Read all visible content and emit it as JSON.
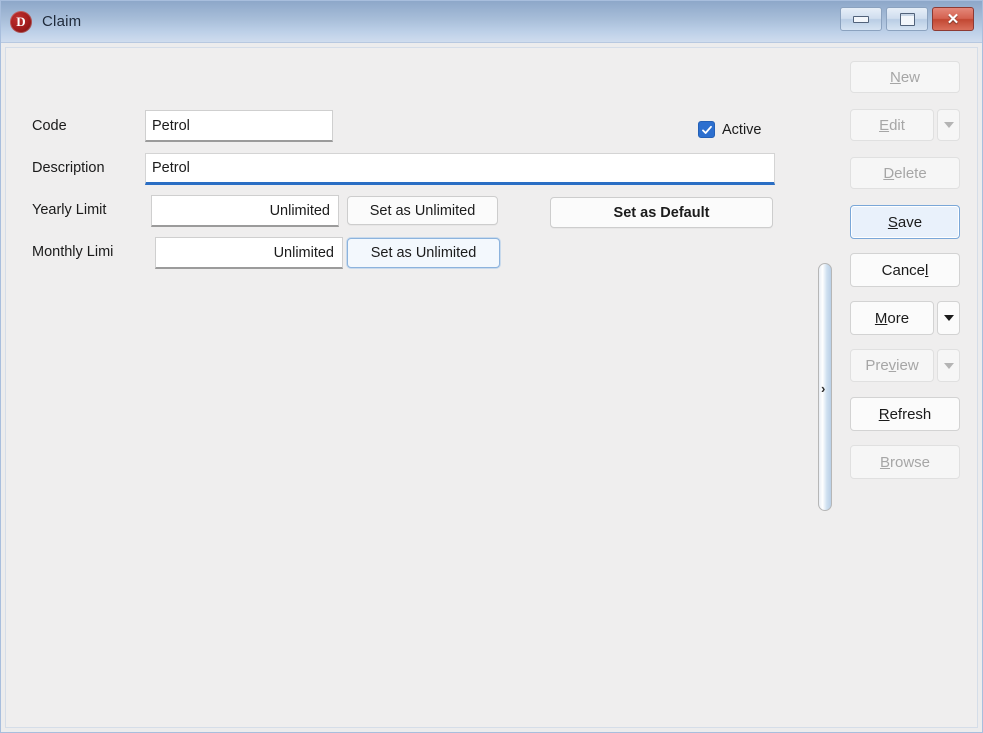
{
  "window": {
    "title": "Claim",
    "app_icon": "app-logo-d-icon",
    "controls": {
      "minimize": "minimize-icon",
      "maximize": "maximize-icon",
      "close": "close-icon"
    }
  },
  "form": {
    "fields": [
      {
        "label": "Code",
        "value": "Petrol",
        "placeholder": ""
      },
      {
        "label": "Description",
        "value": "Petrol",
        "placeholder": ""
      },
      {
        "label": "Yearly Limit",
        "value": "Unlimited",
        "placeholder": ""
      },
      {
        "label": "Monthly Limi",
        "value": "Unlimited",
        "placeholder": ""
      }
    ],
    "active_checkbox": {
      "label": "Active",
      "checked": true
    },
    "buttons": {
      "set_unlimited_yearly": "Set as Unlimited",
      "set_unlimited_monthly": "Set as Unlimited",
      "set_as_default": "Set as Default"
    }
  },
  "commands": [
    {
      "label": "New",
      "enabled": false,
      "has_dropdown": false
    },
    {
      "label": "Edit",
      "enabled": false,
      "has_dropdown": true
    },
    {
      "label": "Delete",
      "enabled": false,
      "has_dropdown": false
    },
    {
      "label": "Save",
      "enabled": true,
      "has_dropdown": false
    },
    {
      "label": "Cancel",
      "enabled": true,
      "has_dropdown": false
    },
    {
      "label": "More",
      "enabled": true,
      "has_dropdown": true
    },
    {
      "label": "Preview",
      "enabled": false,
      "has_dropdown": true
    },
    {
      "label": "Refresh",
      "enabled": true,
      "has_dropdown": false
    },
    {
      "label": "Browse",
      "enabled": false,
      "has_dropdown": false
    }
  ],
  "splitter": {
    "arrow": "›"
  }
}
